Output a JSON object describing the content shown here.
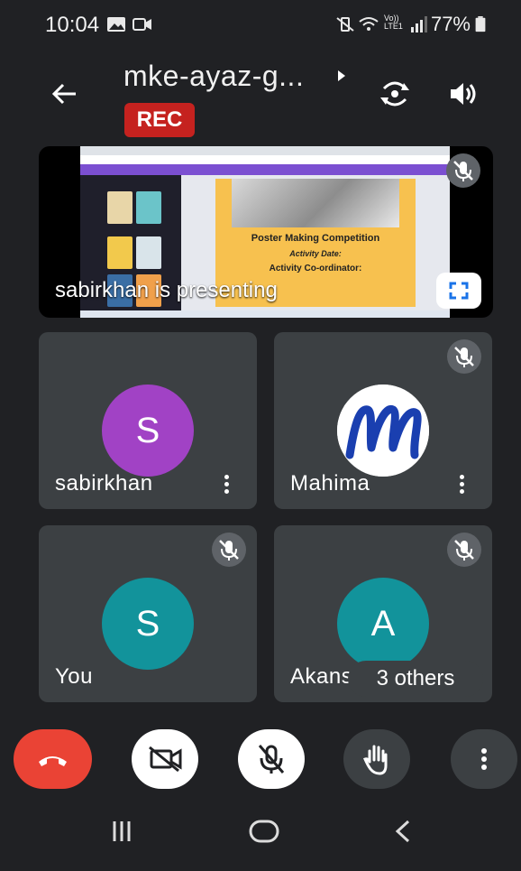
{
  "status_bar": {
    "time": "10:04",
    "network_label": "Vo))\nLTE1",
    "battery": "77%",
    "icons": [
      "image-icon",
      "video-icon",
      "mute-vibrate-icon",
      "wifi-icon",
      "signal-icon",
      "battery-icon"
    ]
  },
  "header": {
    "meeting_title": "mke-ayaz-g...",
    "recording_badge": "REC",
    "icons": [
      "back-arrow-icon",
      "switch-camera-icon",
      "speaker-icon"
    ]
  },
  "presentation": {
    "presenter_label": "sabirkhan is presenting",
    "shared_screen": {
      "poster_title": "Poster Making Competition",
      "poster_line1": "Activity Date:",
      "poster_line2": "Activity Co-ordinator:"
    },
    "icons": [
      "mic-muted-icon",
      "fullscreen-icon"
    ]
  },
  "participants": [
    {
      "name": "sabirkhan",
      "avatar_letter": "S",
      "avatar_color": "#a142c5",
      "muted": false
    },
    {
      "name": "Mahima",
      "avatar_letter": "",
      "avatar_color": "#ffffff",
      "muted": true
    },
    {
      "name": "You",
      "avatar_letter": "S",
      "avatar_color": "#12939b",
      "muted": true
    },
    {
      "name": "Akansha",
      "avatar_letter": "A",
      "avatar_color": "#12939b",
      "muted": true
    }
  ],
  "others_pill": "3 others",
  "controls": [
    "end-call-icon",
    "camera-off-icon",
    "mic-off-icon",
    "raise-hand-icon",
    "more-options-icon"
  ],
  "colors": {
    "end_call": "#ea4335",
    "rec": "#c5221f",
    "tile": "#3c4043",
    "background": "#202124"
  }
}
